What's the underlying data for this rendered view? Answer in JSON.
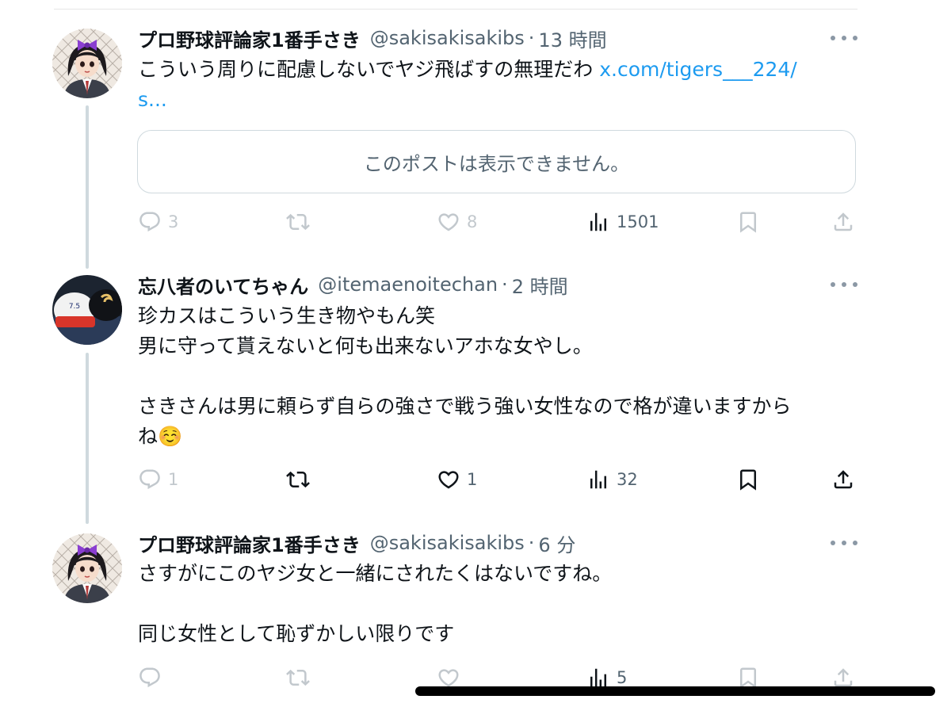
{
  "posts": [
    {
      "name": "プロ野球評論家1番手さき",
      "handle": "@sakisakisakibs",
      "dot": "·",
      "time": "13 時間",
      "text": "こういう周りに配慮しないでヤジ飛ばすの無理だわ ",
      "link": "x.com/tigers___224/\ns...",
      "quote_unavailable": "このポストは表示できません。",
      "replies": "3",
      "likes": "8",
      "views": "1501",
      "avatar_icon": "anime-girl-avatar-icon"
    },
    {
      "name": "忘八者のいてちゃん",
      "handle": "@itemaenoitechan",
      "dot": "·",
      "time": "2 時間",
      "text": "珍カスはこういう生き物やもん笑\n男に守って貰えないと何も出来ないアホな女やし。\n\nさきさんは男に頼らず自らの強さで戦う強い女性なので格が違いますから\nね☺️",
      "replies": "1",
      "likes": "1",
      "views": "32",
      "avatar_icon": "helmets-photo-avatar-icon"
    },
    {
      "name": "プロ野球評論家1番手さき",
      "handle": "@sakisakisakibs",
      "dot": "·",
      "time": "6 分",
      "text": "さすがにこのヤジ女と一緒にされたくはないですね。\n\n同じ女性として恥ずかしい限りです",
      "views": "5",
      "avatar_icon": "anime-girl-avatar-icon"
    }
  ],
  "colors": {
    "link": "#1d9bf0",
    "secondary_text": "#536471",
    "primary_text": "#0f1419",
    "thread_line": "#cfd9de"
  }
}
